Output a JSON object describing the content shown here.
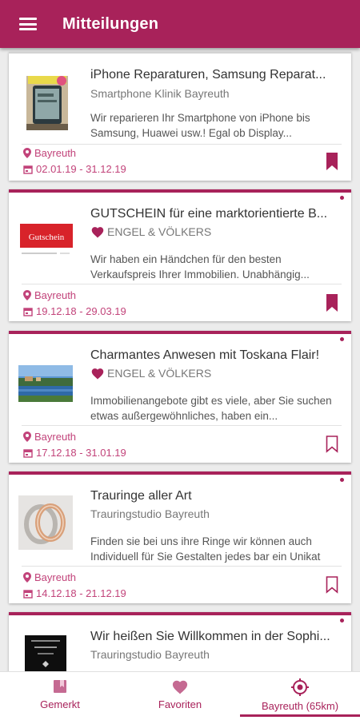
{
  "appbar": {
    "title": "Mitteilungen",
    "menu_icon": "hamburger-menu-icon"
  },
  "theme": {
    "primary": "#a8225a",
    "accent_text": "#c2437a"
  },
  "messages": [
    {
      "title": "iPhone Reparaturen, Samsung Reparat...",
      "sender": "Smartphone Klinik Bayreuth",
      "favorite_sender": false,
      "description": "Wir reparieren Ihr Smartphone von iPhone bis Samsung, Huawei usw.! Egal ob Display...",
      "location": "Bayreuth",
      "dates": "02.01.19 - 31.12.19",
      "bookmarked": true,
      "unread": false
    },
    {
      "title": "GUTSCHEIN für eine marktorientierte B...",
      "sender": "ENGEL & VÖLKERS",
      "favorite_sender": true,
      "description": "Wir haben ein Händchen für den besten Verkaufspreis Ihrer Immobilien. Unabhängig...",
      "location": "Bayreuth",
      "dates": "19.12.18 - 29.03.19",
      "bookmarked": true,
      "unread": true,
      "thumb_text": "Gutschein"
    },
    {
      "title": "Charmantes Anwesen mit Toskana Flair!",
      "sender": "ENGEL & VÖLKERS",
      "favorite_sender": true,
      "description": "Immobilienangebote gibt es viele, aber Sie suchen etwas außergewöhnliches, haben ein...",
      "location": "Bayreuth",
      "dates": "17.12.18 - 31.01.19",
      "bookmarked": false,
      "unread": true
    },
    {
      "title": "Trauringe aller Art",
      "sender": "Trauringstudio Bayreuth",
      "favorite_sender": false,
      "description": "Finden sie bei uns ihre Ringe wir können auch Individuell für Sie Gestalten jedes bar ein Unikat",
      "location": "Bayreuth",
      "dates": "14.12.18 - 21.12.19",
      "bookmarked": false,
      "unread": true
    },
    {
      "title": "Wir heißen Sie Willkommen in der Sophi...",
      "sender": "Trauringstudio Bayreuth",
      "favorite_sender": false,
      "description": "",
      "location": "",
      "dates": "",
      "bookmarked": false,
      "unread": true
    }
  ],
  "bottom_nav": [
    {
      "label": "Gemerkt",
      "icon": "bookmarks-icon",
      "active": false
    },
    {
      "label": "Favoriten",
      "icon": "heart-icon",
      "active": false
    },
    {
      "label": "Bayreuth (65km)",
      "icon": "location-target-icon",
      "active": true
    }
  ]
}
